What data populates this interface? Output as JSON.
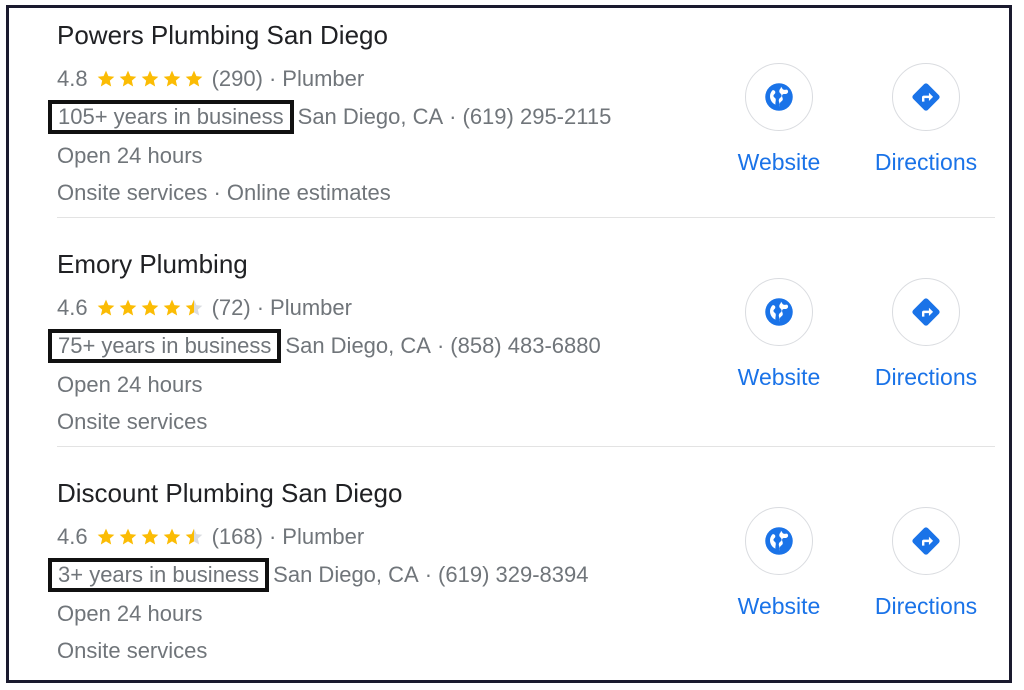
{
  "colors": {
    "link_blue": "#1a73e8",
    "star_gold": "#fbbc04",
    "text_gray": "#70757a",
    "title": "#202124"
  },
  "listings": [
    {
      "name": "Powers Plumbing San Diego",
      "rating": "4.8",
      "stars": 4.8,
      "reviews": "(290)",
      "category": "Plumber",
      "years": "105+ years in business",
      "location": "San Diego, CA",
      "phone": "(619) 295-2115",
      "hours": "Open 24 hours",
      "services": "Onsite services · Online estimates",
      "website_label": "Website",
      "directions_label": "Directions"
    },
    {
      "name": "Emory Plumbing",
      "rating": "4.6",
      "stars": 4.6,
      "reviews": "(72)",
      "category": "Plumber",
      "years": "75+ years in business",
      "location": "San Diego, CA",
      "phone": "(858) 483-6880",
      "hours": "Open 24 hours",
      "services": "Onsite services",
      "website_label": "Website",
      "directions_label": "Directions"
    },
    {
      "name": "Discount Plumbing San Diego",
      "rating": "4.6",
      "stars": 4.6,
      "reviews": "(168)",
      "category": "Plumber",
      "years": "3+ years in business",
      "location": "San Diego, CA",
      "phone": "(619) 329-8394",
      "hours": "Open 24 hours",
      "services": "Onsite services",
      "website_label": "Website",
      "directions_label": "Directions"
    }
  ],
  "separator": "·",
  "icons": {
    "website": "globe-icon",
    "directions": "directions-arrow-icon",
    "star": "star-icon"
  }
}
